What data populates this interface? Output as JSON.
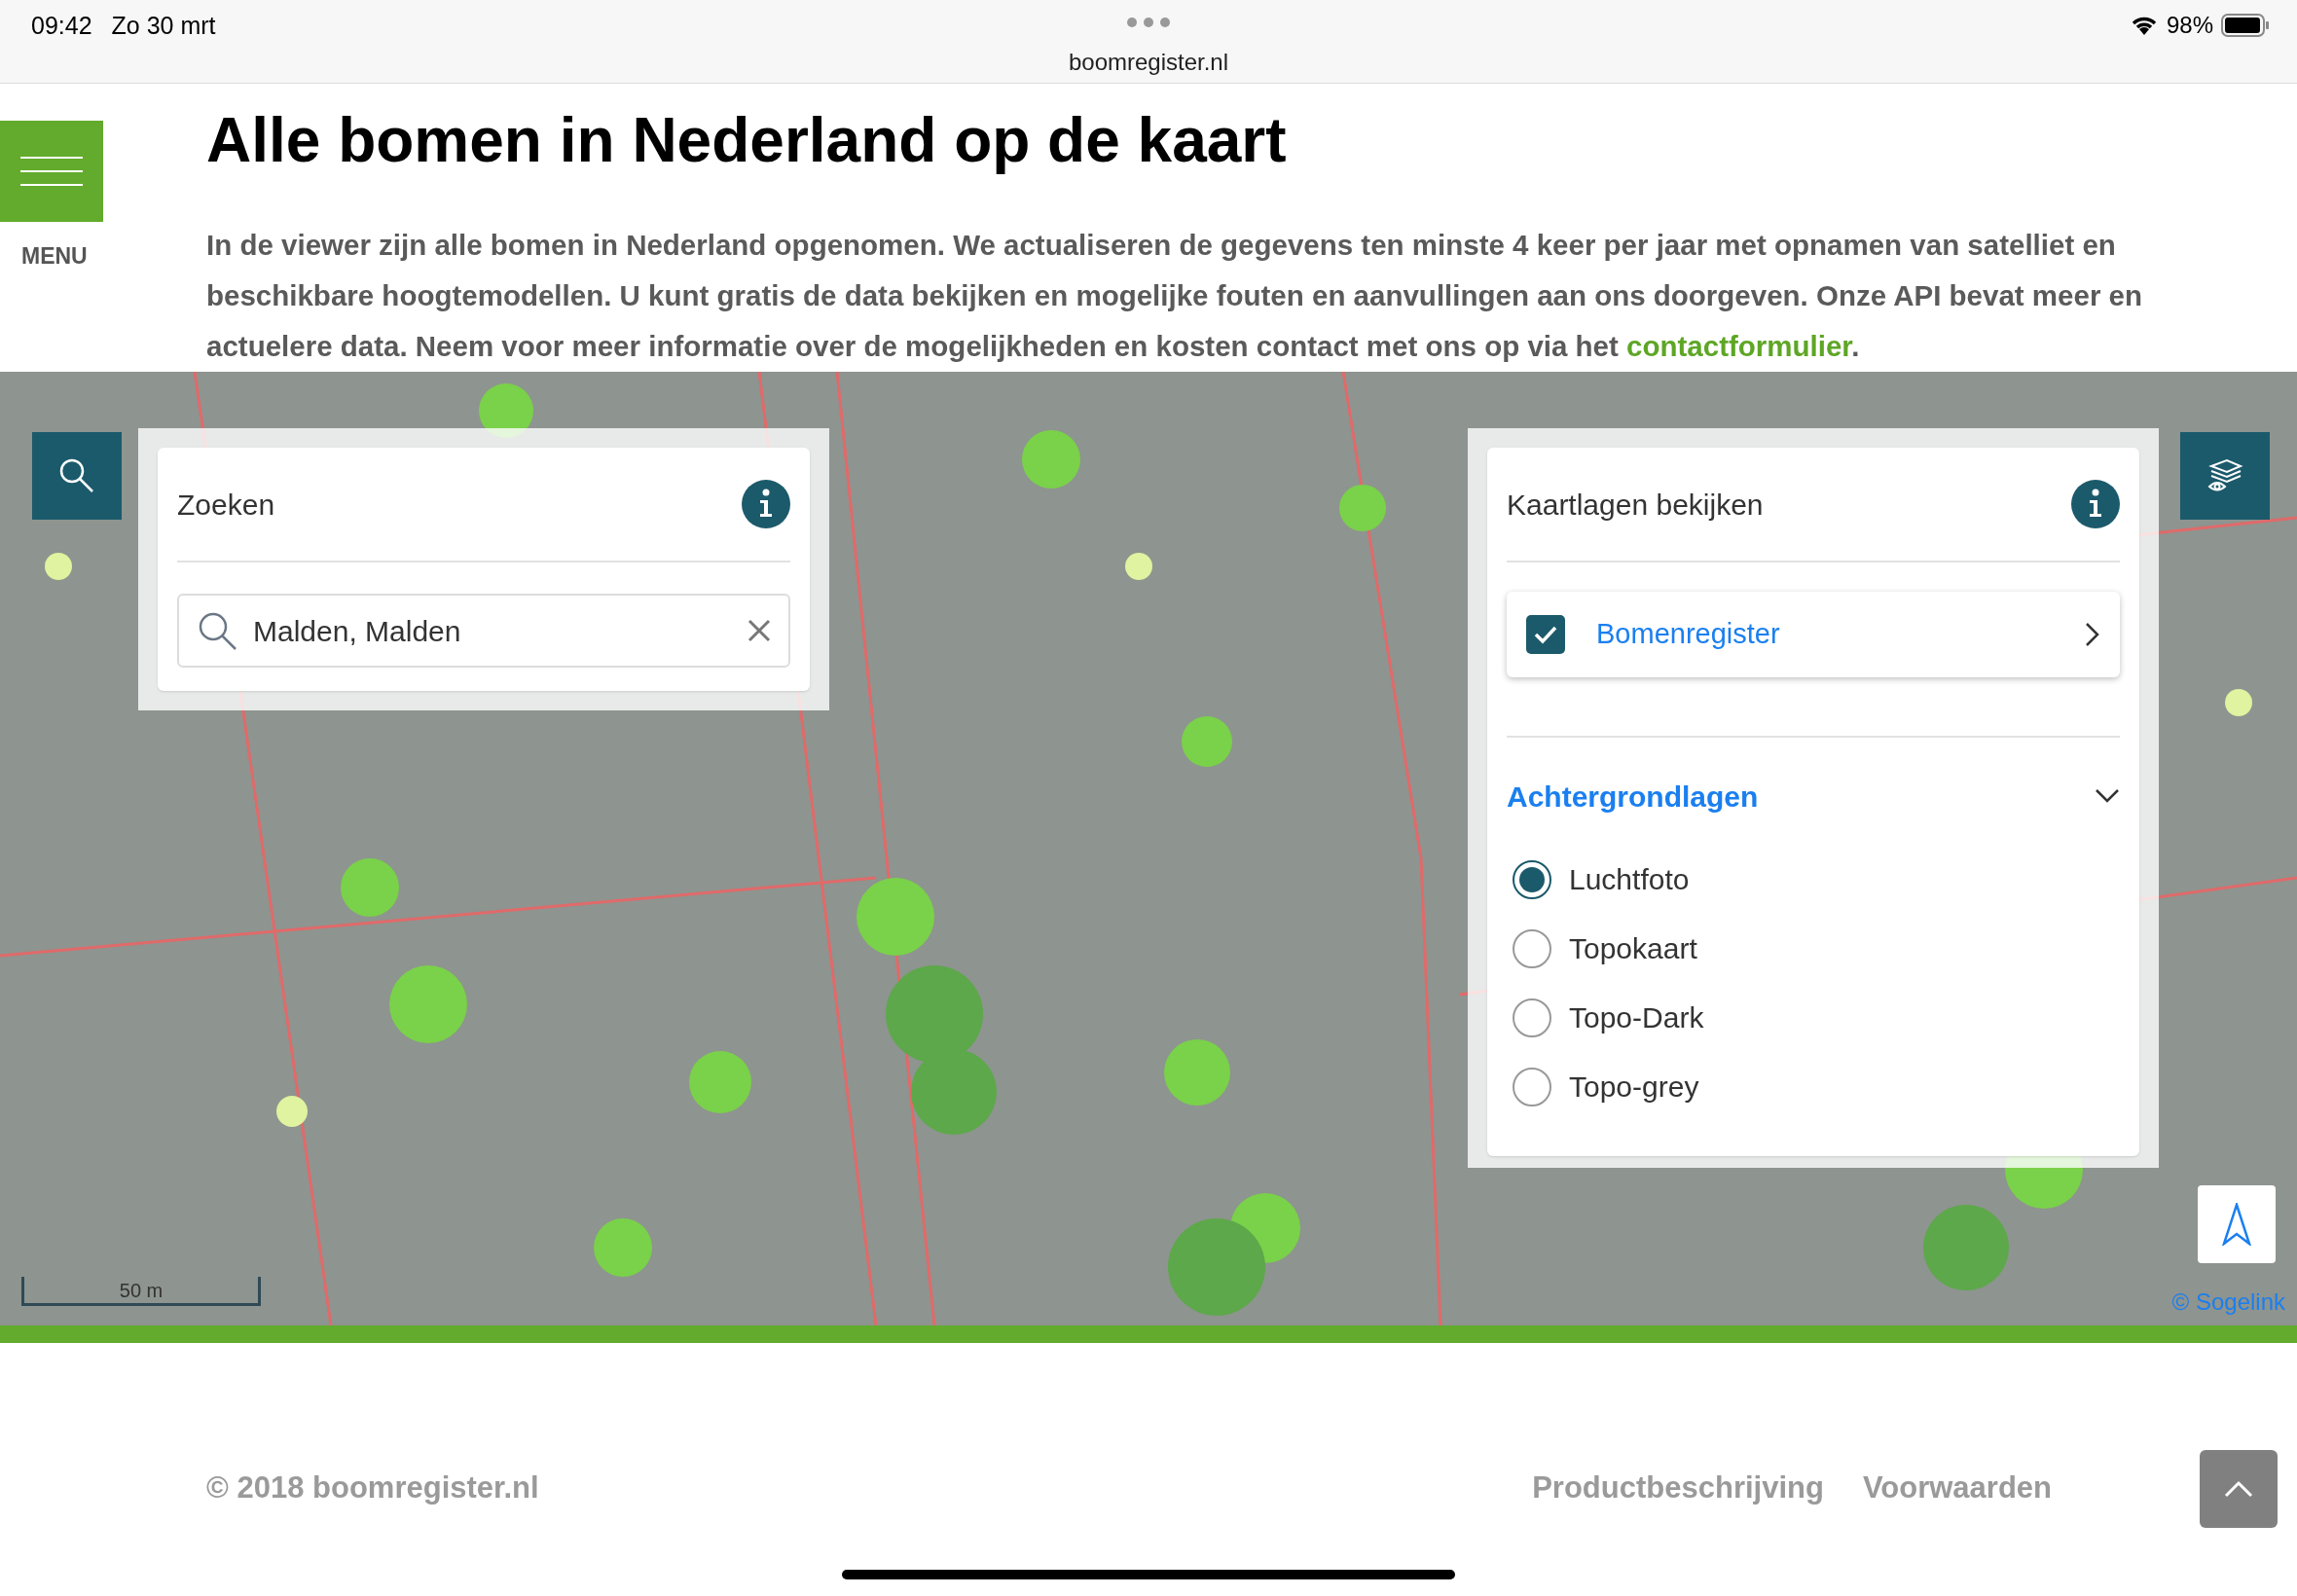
{
  "status_bar": {
    "time": "09:42",
    "date": "Zo 30 mrt",
    "url": "boomregister.nl",
    "battery": "98%"
  },
  "header": {
    "menu_label": "MENU",
    "title": "Alle bomen in Nederland op de kaart",
    "intro": {
      "text": "In de viewer zijn alle bomen in Nederland opgenomen. We actualiseren de gegevens ten minste 4 keer per jaar met opnamen van satelliet en beschikbare hoogtemodellen. U kunt gratis de data bekijken en mogelijke fouten en aanvullingen aan ons doorgeven. Onze API bevat meer en actuelere data. Neem voor meer informatie over de mogelijkheden en kosten contact met ons op via het ",
      "link": "contactformulier",
      "after": "."
    }
  },
  "search_panel": {
    "title": "Zoeken",
    "query": "Malden, Malden"
  },
  "layers_panel": {
    "title": "Kaartlagen bekijken",
    "layers": [
      {
        "label": "Bomenregister",
        "checked": true
      }
    ],
    "background_section": {
      "title": "Achtergrondlagen",
      "expanded": true,
      "options": [
        {
          "label": "Luchtfoto",
          "selected": true
        },
        {
          "label": "Topokaart",
          "selected": false
        },
        {
          "label": "Topo-Dark",
          "selected": false
        },
        {
          "label": "Topo-grey",
          "selected": false
        }
      ]
    }
  },
  "map": {
    "scale_label": "50 m",
    "attribution": "© Sogelink"
  },
  "footer": {
    "copyright": "© 2018 boomregister.nl",
    "links": [
      "Productbeschrijving",
      "Voorwaarden"
    ]
  }
}
